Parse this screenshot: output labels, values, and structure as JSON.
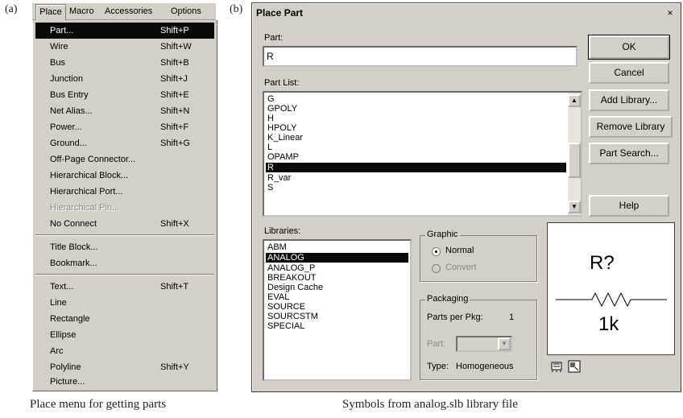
{
  "figure": {
    "label_a": "(a)",
    "label_b": "(b)",
    "caption_a": "Place menu for getting parts",
    "caption_b": "Symbols from analog.slb library file"
  },
  "menubar": {
    "items": [
      "Place",
      "Macro",
      "Accessories",
      "Options"
    ]
  },
  "menu": {
    "items": [
      {
        "label": "Part...",
        "shortcut": "Shift+P"
      },
      {
        "label": "Wire",
        "shortcut": "Shift+W"
      },
      {
        "label": "Bus",
        "shortcut": "Shift+B"
      },
      {
        "label": "Junction",
        "shortcut": "Shift+J"
      },
      {
        "label": "Bus Entry",
        "shortcut": "Shift+E"
      },
      {
        "label": "Net Alias...",
        "shortcut": "Shift+N"
      },
      {
        "label": "Power...",
        "shortcut": "Shift+F"
      },
      {
        "label": "Ground...",
        "shortcut": "Shift+G"
      },
      {
        "label": "Off-Page Connector...",
        "shortcut": ""
      },
      {
        "label": "Hierarchical Block...",
        "shortcut": ""
      },
      {
        "label": "Hierarchical Port...",
        "shortcut": ""
      },
      {
        "label": "Hierarchical Pin...",
        "shortcut": ""
      },
      {
        "label": "No Connect",
        "shortcut": "Shift+X"
      },
      {
        "label": "Title Block...",
        "shortcut": ""
      },
      {
        "label": "Bookmark...",
        "shortcut": ""
      },
      {
        "label": "Text...",
        "shortcut": "Shift+T"
      },
      {
        "label": "Line",
        "shortcut": ""
      },
      {
        "label": "Rectangle",
        "shortcut": ""
      },
      {
        "label": "Ellipse",
        "shortcut": ""
      },
      {
        "label": "Arc",
        "shortcut": ""
      },
      {
        "label": "Polyline",
        "shortcut": "Shift+Y"
      },
      {
        "label": "Picture...",
        "shortcut": ""
      }
    ]
  },
  "dialog": {
    "title": "Place Part",
    "close_glyph": "×",
    "part_label": "Part:",
    "part_value": "R",
    "part_list_label": "Part List:",
    "part_list": [
      "G",
      "GPOLY",
      "H",
      "HPOLY",
      "K_Linear",
      "L",
      "OPAMP",
      "R",
      "R_var",
      "S"
    ],
    "selected_part": "R",
    "libraries_label": "Libraries:",
    "libraries": [
      "ABM",
      "ANALOG",
      "ANALOG_P",
      "BREAKOUT",
      "Design Cache",
      "EVAL",
      "SOURCE",
      "SOURCSTM",
      "SPECIAL"
    ],
    "selected_library": "ANALOG",
    "buttons": {
      "ok": "OK",
      "cancel": "Cancel",
      "add_library": "Add Library...",
      "remove_library": "Remove Library",
      "part_search": "Part Search...",
      "help": "Help"
    },
    "graphic": {
      "title": "Graphic",
      "normal": "Normal",
      "convert": "Convert",
      "selected": "Normal"
    },
    "packaging": {
      "title": "Packaging",
      "parts_per_pkg_label": "Parts per Pkg:",
      "parts_per_pkg_value": "1",
      "part_label": "Part:",
      "type_label": "Type:",
      "type_value": "Homogeneous"
    },
    "preview": {
      "ref": "R?",
      "value": "1k"
    }
  }
}
